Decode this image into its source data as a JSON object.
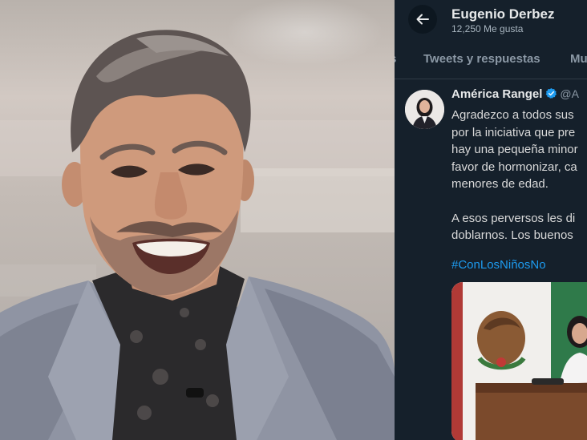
{
  "twitter": {
    "back_icon": "arrow-left-icon",
    "profile_name": "Eugenio Derbez",
    "profile_likes": "12,250 Me gusta",
    "tabs": [
      {
        "label": "s"
      },
      {
        "label": "Tweets y respuestas"
      },
      {
        "label": "Mu"
      }
    ],
    "tweet": {
      "author_name": "América Rangel",
      "verified_icon": "verified-badge-icon",
      "handle": "@A",
      "lines": [
        "Agradezco a todos sus",
        "por la iniciativa que pre",
        "hay una pequeña minor",
        "favor de hormonizar, ca",
        "menores de edad.",
        "A esos perversos les di",
        "doblarnos. Los buenos"
      ],
      "hashtag": "#ConLosNiñosNo"
    },
    "colors": {
      "background": "#15202b",
      "link": "#1d9bf0",
      "verified": "#1d9bf0"
    }
  },
  "photo": {
    "subject": "smiling man with grey hair and beard in grey blazer"
  }
}
